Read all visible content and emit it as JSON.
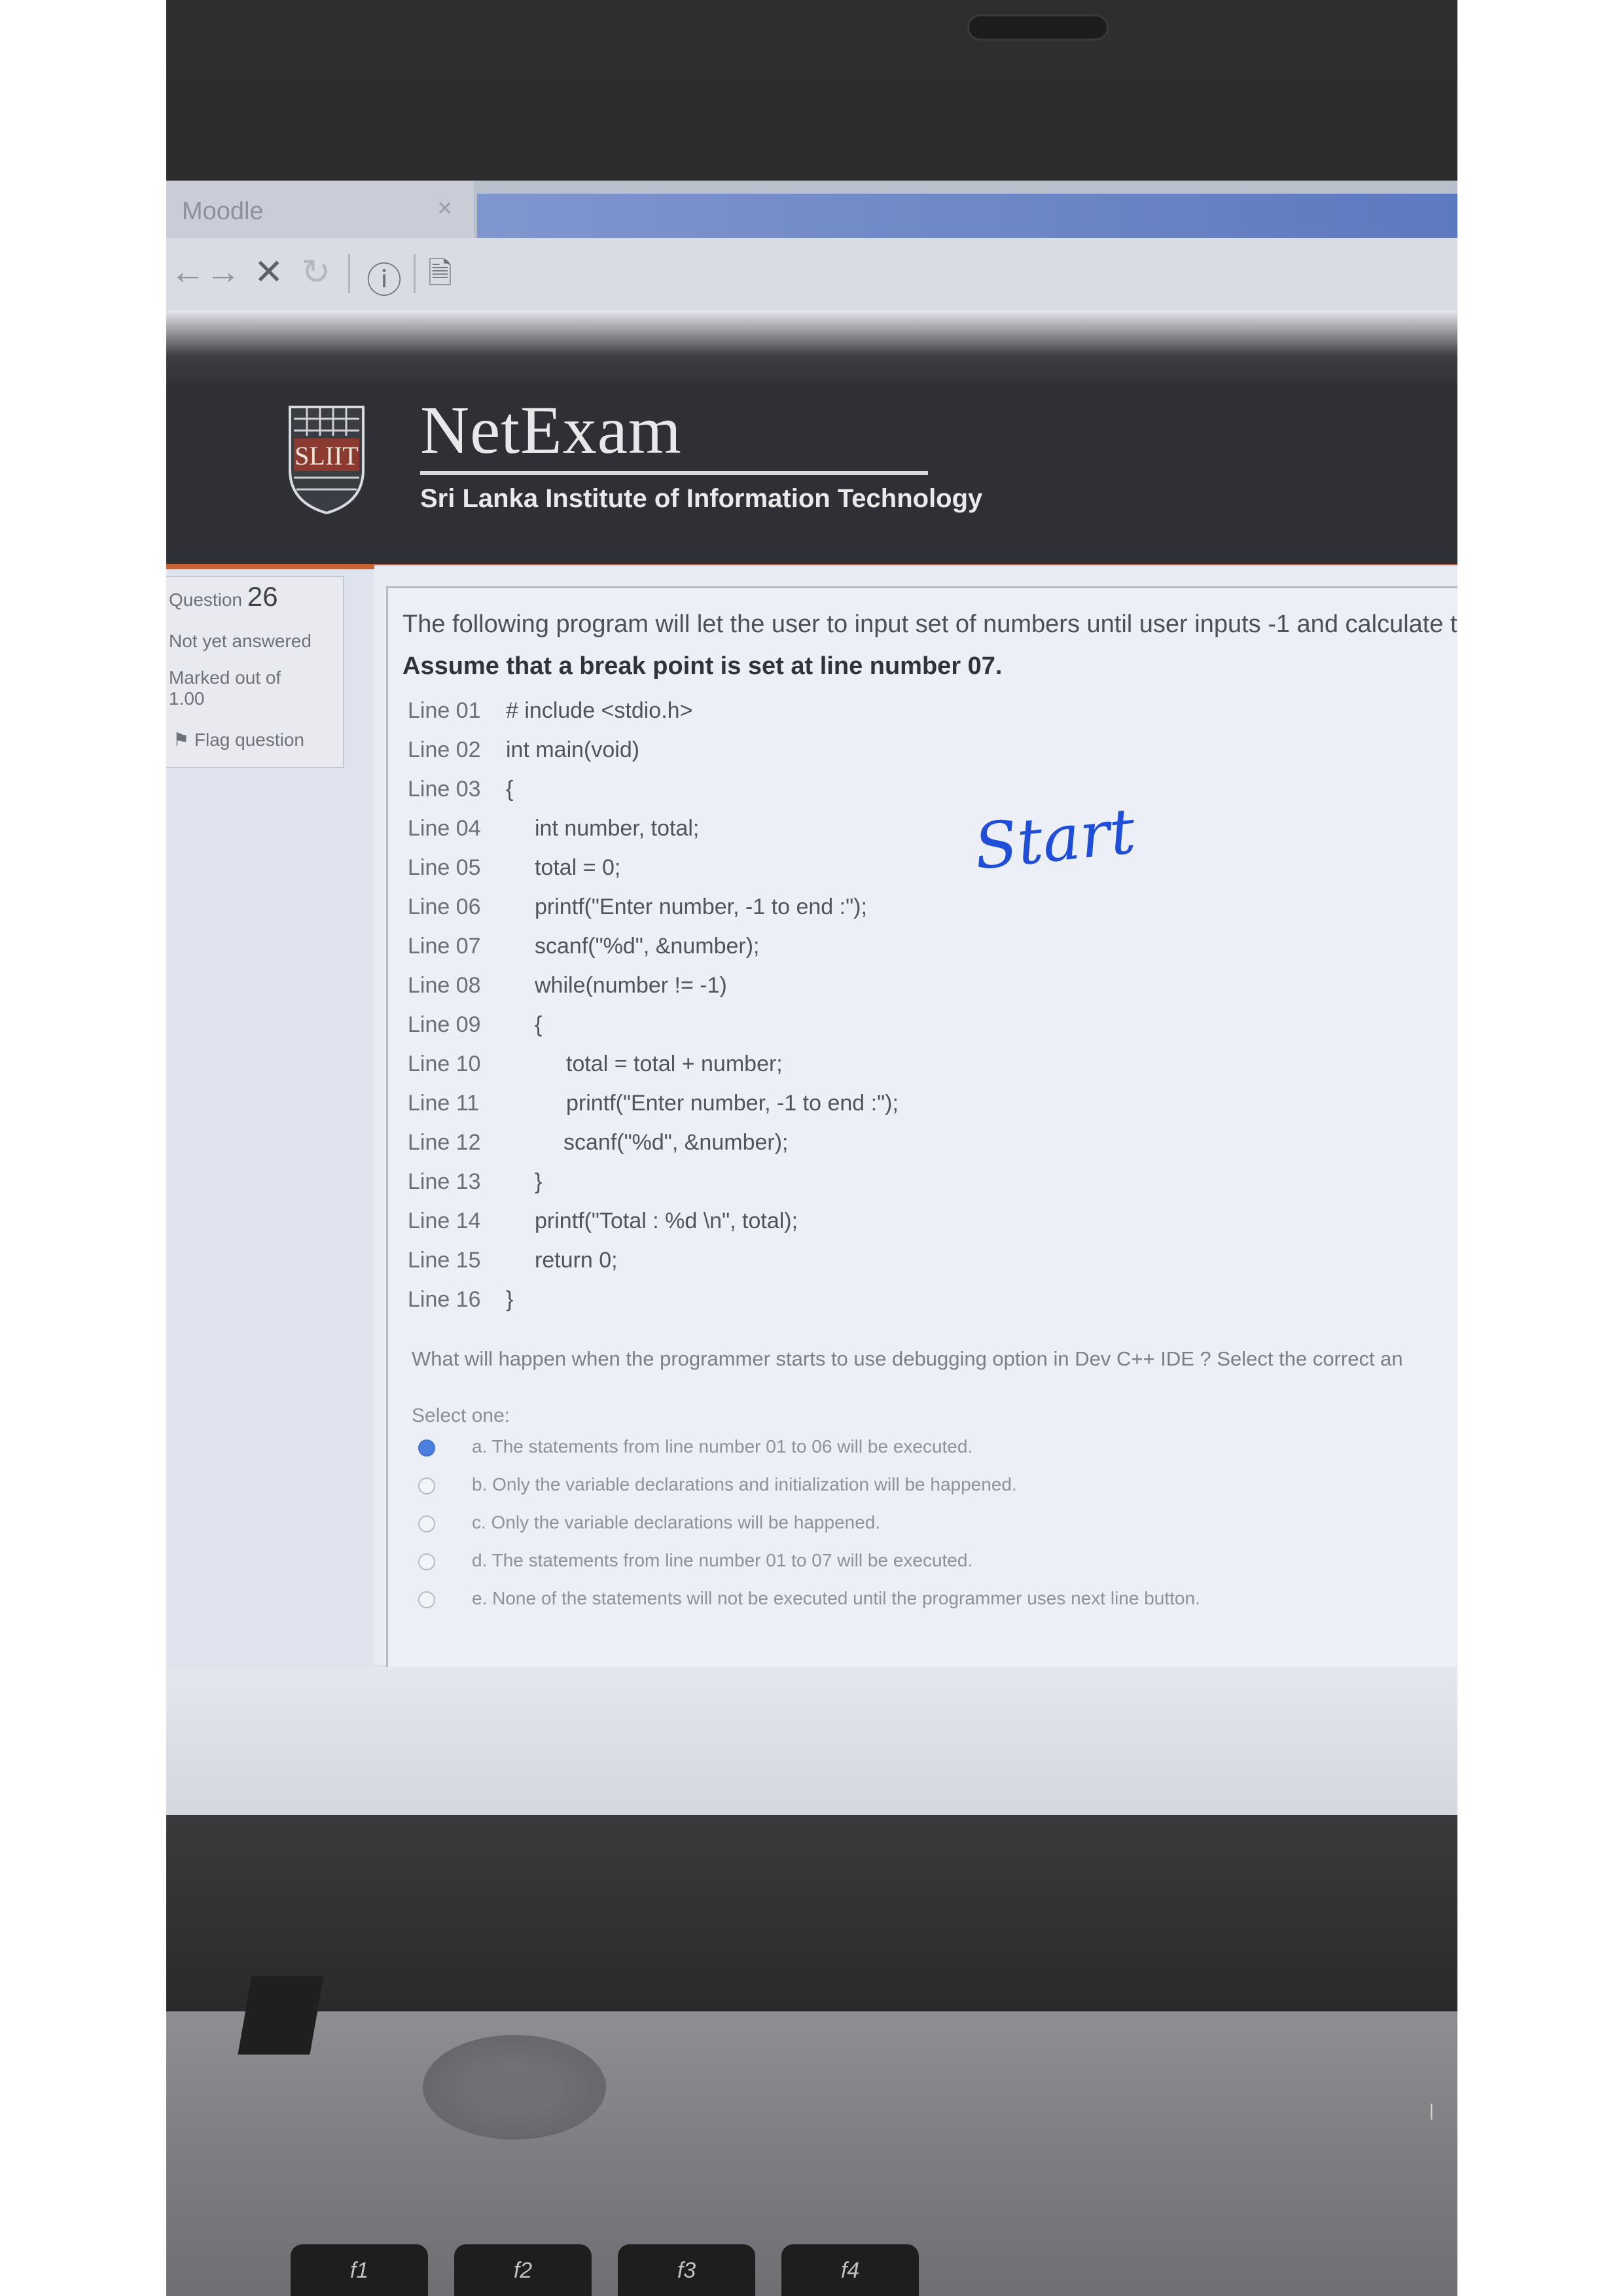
{
  "browser": {
    "tab_title": "Moodle",
    "tab_close": "×",
    "nav": {
      "back": "←",
      "forward": "→",
      "stop": "✕",
      "reload": "↻",
      "info": "ⓘ",
      "page": "🗎"
    }
  },
  "header": {
    "brand": "NetExam",
    "subtitle": "Sri Lanka Institute of Information Technology",
    "logo_text": "SLIIT"
  },
  "question_info": {
    "label": "Question",
    "number": "26",
    "status": "Not yet answered",
    "marked_out_of": "Marked out of",
    "marks": "1.00",
    "flag": "Flag question"
  },
  "question": {
    "text": "The following program will let the user to input set of numbers until user inputs -1 and calculate the t",
    "assumption": "Assume that a  break point is set at line number 07.",
    "code": [
      {
        "line": "Line 01",
        "code": "# include <stdio.h>"
      },
      {
        "line": "Line 02",
        "code": "int main(void)"
      },
      {
        "line": "Line 03",
        "code": "{"
      },
      {
        "line": "Line 04",
        "code": "int number, total;"
      },
      {
        "line": "Line 05",
        "code": "total = 0;"
      },
      {
        "line": "Line 06",
        "code": "printf(\"Enter number, -1 to end :\");"
      },
      {
        "line": "Line 07",
        "code": "scanf(\"%d\", &number);"
      },
      {
        "line": "Line 08",
        "code": "while(number != -1)"
      },
      {
        "line": "Line 09",
        "code": "{"
      },
      {
        "line": "Line 10",
        "code": "total = total + number;"
      },
      {
        "line": "Line 11",
        "code": "printf(\"Enter number, -1 to end :\");"
      },
      {
        "line": "Line 12",
        "code": "scanf(\"%d\", &number);"
      },
      {
        "line": "Line 13",
        "code": "}"
      },
      {
        "line": "Line 14",
        "code": "printf(\"Total : %d \\n\", total);"
      },
      {
        "line": "Line 15",
        "code": "return 0;"
      },
      {
        "line": "Line 16",
        "code": "}"
      }
    ],
    "prompt": "What will happen when the programmer starts to use debugging option in Dev C++ IDE ? Select the correct an",
    "select_one": "Select one:",
    "options": [
      {
        "text": "a. The statements from line number 01 to 06 will be executed.",
        "selected": true
      },
      {
        "text": "b. Only the variable declarations and initialization will be happened.",
        "selected": false
      },
      {
        "text": "c. Only the variable declarations will be happened.",
        "selected": false
      },
      {
        "text": "d. The statements from line number 01 to 07 will be executed.",
        "selected": false
      },
      {
        "text": "e. None of the statements will not be executed until the programmer uses next line button.",
        "selected": false
      }
    ]
  },
  "annotation": {
    "text": "Start",
    "color": "#1f4fd8"
  },
  "keyboard": {
    "keys": [
      "f1",
      "f2",
      "f3",
      "f4"
    ]
  },
  "colors": {
    "header_bg": "#2e3035",
    "header_accent": "#c9622e",
    "selected_radio": "#4d7fe0"
  }
}
